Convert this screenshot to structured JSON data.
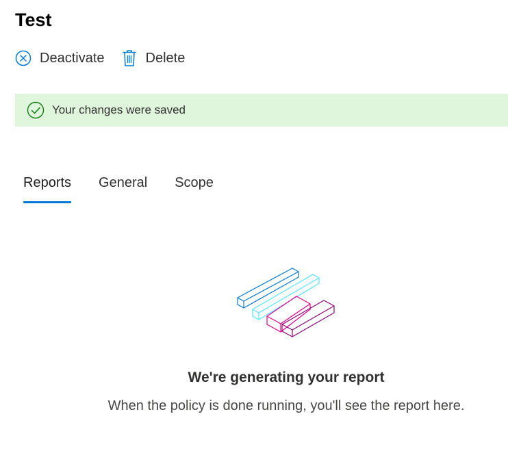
{
  "page": {
    "title": "Test"
  },
  "commands": {
    "deactivate": {
      "label": "Deactivate",
      "icon": "circle-x-icon"
    },
    "delete": {
      "label": "Delete",
      "icon": "trash-icon"
    }
  },
  "message_bar": {
    "text": "Your changes were saved",
    "icon": "checkmark-circle-icon",
    "background": "#dff6dd",
    "icon_color": "#107c10"
  },
  "tabs": [
    {
      "label": "Reports",
      "selected": true
    },
    {
      "label": "General",
      "selected": false
    },
    {
      "label": "Scope",
      "selected": false
    }
  ],
  "empty_state": {
    "illustration": "generating-report-illustration",
    "title": "We're generating your report",
    "subtitle": "When the policy is done running, you'll see the report here."
  },
  "colors": {
    "accent": "#0078d4",
    "illustration_blue": "#0078d4",
    "illustration_cyan": "#50e6ff",
    "illustration_magenta": "#e3008c",
    "illustration_purple": "#8b0076"
  }
}
